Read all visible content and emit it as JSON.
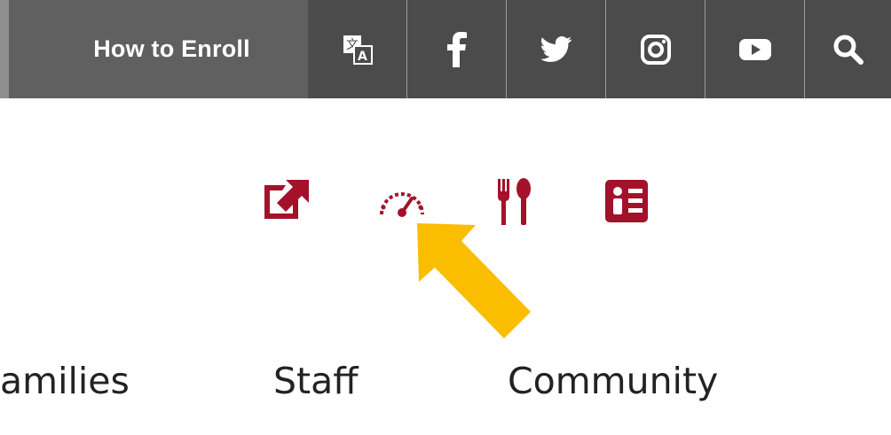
{
  "topbar": {
    "enroll_label": "How to Enroll",
    "icons": [
      "translate-icon",
      "facebook-icon",
      "twitter-icon",
      "instagram-icon",
      "youtube-icon",
      "search-icon"
    ]
  },
  "quick_links": {
    "icons": [
      "external-link-icon",
      "dashboard-gauge-icon",
      "fork-spoon-icon",
      "id-card-icon"
    ]
  },
  "annotation": {
    "arrow_color": "#fbbd00"
  },
  "nav": {
    "items": [
      "amilies",
      "Staff",
      "Community"
    ]
  },
  "colors": {
    "topbar_light": "#606060",
    "topbar_dark": "#4b4b4b",
    "accent_maroon": "#a3122a",
    "text": "#222222"
  }
}
